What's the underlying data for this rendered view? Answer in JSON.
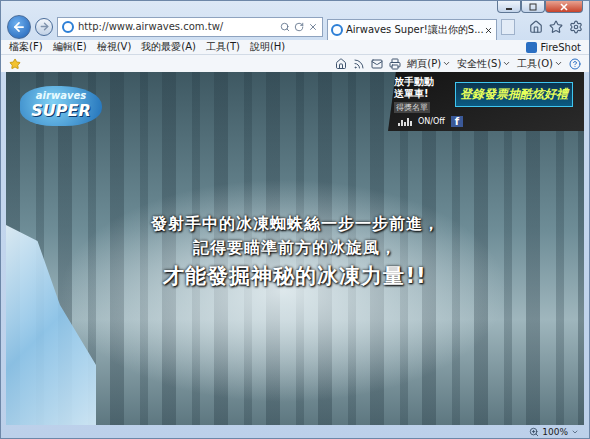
{
  "window": {
    "controls": [
      "minimize",
      "maximize",
      "close"
    ]
  },
  "address": {
    "url": "http://www.airwaves.com.tw/"
  },
  "tabs": [
    {
      "label": "Airwaves Super!讓出你的S...",
      "selected": true
    }
  ],
  "menu": [
    "檔案(F)",
    "編輯(E)",
    "檢視(V)",
    "我的最愛(A)",
    "工具(T)",
    "說明(H)"
  ],
  "addons": [
    "FireShot"
  ],
  "command_bar": [
    "網頁(P)",
    "安全性(S)",
    "工具(O)"
  ],
  "page": {
    "logo": {
      "top": "airwaves",
      "bottom": "SUPER"
    },
    "promo": {
      "lines": [
        "放手動動",
        "送單車!"
      ],
      "winners": "得獎名單",
      "headline": "登錄發票抽酷炫好禮",
      "sound": "ON/Off",
      "facebook": "f"
    },
    "message": [
      "發射手中的冰凍蜘蛛絲一步一步前進，",
      "記得要瞄準前方的冰旋風，",
      "才能發掘神秘的冰凍力量!!"
    ]
  },
  "status_bar": {
    "zoom": "100%"
  }
}
